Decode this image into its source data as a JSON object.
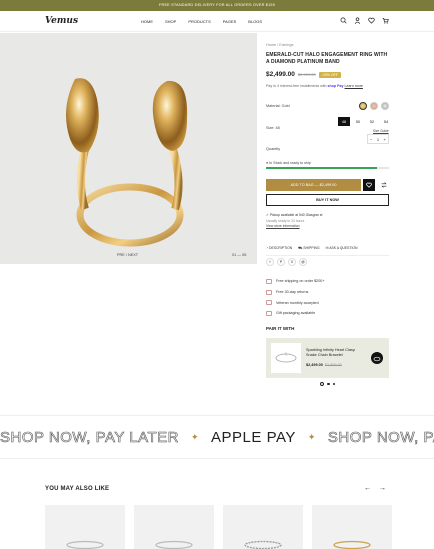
{
  "announcement": "FREE STANDARD DELIVERY FOR ALL ORDERS OVER $150",
  "header": {
    "logo": "Vemus",
    "nav": [
      "HOME",
      "SHOP",
      "PRODUCTS",
      "PAGES",
      "BLOGS"
    ],
    "icons": [
      "search-icon",
      "account-icon",
      "heart-icon",
      "cart-icon"
    ]
  },
  "gallery": {
    "prev_next": "PRE / NEXT",
    "pager": "01 — 05"
  },
  "product": {
    "breadcrumb": "Home  /  Earrings",
    "title": "EMERALD-CUT HALO ENGAGEMENT RING WITH A DIAMOND PLATINUM BAND",
    "price": "$2,499.00",
    "old_price": "$2,999.00",
    "badge": "-20% OFF",
    "installment_pre": "Pay in 4 interest-free installments with",
    "shoppay": "shop Pay",
    "installment_link": "Learn more",
    "material_label": "Material: Gold",
    "size_label": "Size: 48",
    "sizes": [
      "48",
      "50",
      "52",
      "54"
    ],
    "size_guide": "Size Guide",
    "quantity_label": "Quantity",
    "quantity_value": "1",
    "stock_text": "In Stock and ready to ship",
    "stock_level": 0.9,
    "add_to_cart": "ADD TO BAG  —  $2,499.00",
    "buy_now": "BUY IT NOW",
    "pickup_line": "Pickup available at 540 Glasgow st",
    "pickup_sub": "Usually ready in 24 hours",
    "pickup_link": "View store information",
    "actions": [
      "DESCRIPTION",
      "SHIPPING",
      "ASK A QUESTION"
    ],
    "social": [
      "f",
      "P",
      "X",
      "@"
    ],
    "features": [
      "Free shipping on order $200+",
      "Free 30-day returns",
      "Veteran monthly accepted",
      "Gift packaging available"
    ]
  },
  "pair": {
    "title": "PAIR IT WITH",
    "name": "Sparkling Infinity Heart Clasp Snake Chain Bracelet",
    "price": "$2,499.00",
    "old_price": "$2,999.00"
  },
  "marquee": {
    "outline_1": "SHOP NOW, PAY LATER",
    "solid": "APPLE PAY",
    "outline_2": "SHOP NOW, PA"
  },
  "also": {
    "title": "YOU MAY ALSO LIKE"
  }
}
